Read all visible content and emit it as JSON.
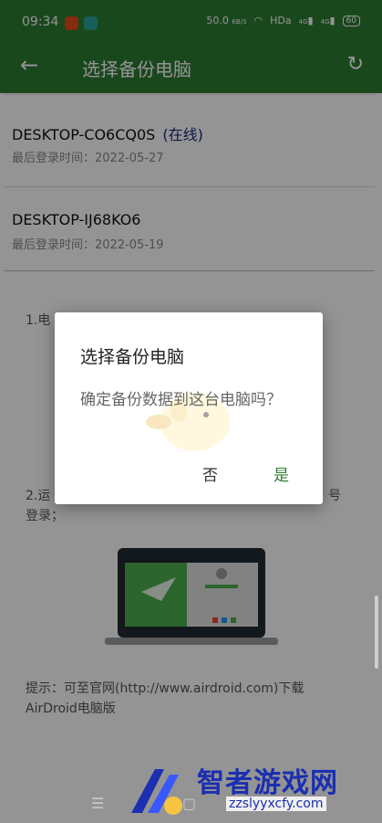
{
  "status_bar": {
    "time": "09:34",
    "network_speed": "50.0",
    "network_unit": "KB/S",
    "hd_label": "HDa",
    "signal1": "4G",
    "signal2": "4G",
    "battery": "60"
  },
  "app_bar": {
    "title": "选择备份电脑"
  },
  "devices": [
    {
      "name": "DESKTOP-CO6CQ0S",
      "status": "(在线)",
      "last_login": "最后登录时间：2022-05-27"
    },
    {
      "name": "DESKTOP-IJ68KO6",
      "status": "",
      "last_login": "最后登录时间：2022-05-19"
    }
  ],
  "instructions": {
    "step1": "1.电",
    "step2": "2.运",
    "step2_suffix": "号",
    "step2_line2": "登录；",
    "tip_line1": "提示：可至官网(http://www.airdroid.com)下载",
    "tip_line2": "AirDroid电脑版"
  },
  "dialog": {
    "title": "选择备份电脑",
    "message": "确定备份数据到这台电脑吗？",
    "cancel_label": "否",
    "confirm_label": "是"
  },
  "watermark": {
    "text": "智者游戏网",
    "sub": "zzslyyxcfy.com"
  },
  "colors": {
    "primary": "#2e7d32",
    "online": "#1a237e",
    "watermark": "#1b2fb0"
  }
}
